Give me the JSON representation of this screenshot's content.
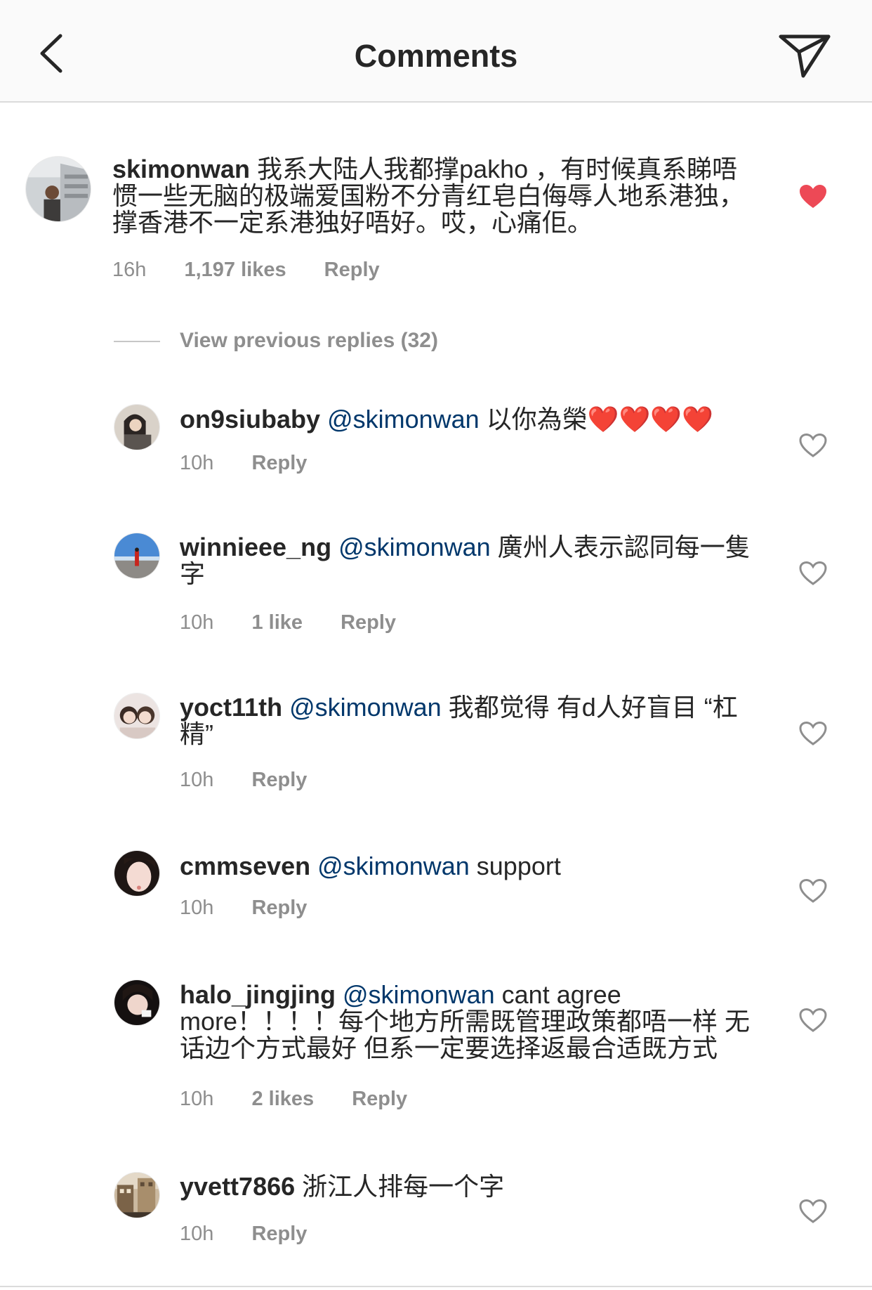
{
  "header": {
    "title": "Comments"
  },
  "main_comment": {
    "username": "skimonwan",
    "text": "我系大陆人我都撑pakho ，有时候真系睇唔惯一些无脑的极端爱国粉不分青红皂白侮辱人地系港独，撑香港不一定系港独好唔好。哎，心痛佢。",
    "time": "16h",
    "likes": "1,197 likes",
    "reply": "Reply",
    "liked": true
  },
  "view_previous": "View previous replies (32)",
  "replies": [
    {
      "username": "on9siubaby",
      "mention": "@skimonwan",
      "text": "以你為榮❤️❤️❤️❤️",
      "time": "10h",
      "likes": "",
      "reply": "Reply"
    },
    {
      "username": "winnieee_ng",
      "mention": "@skimonwan",
      "text": "廣州人表示認同每一隻字",
      "time": "10h",
      "likes": "1 like",
      "reply": "Reply"
    },
    {
      "username": "yoct11th",
      "mention": "@skimonwan",
      "text": "我都觉得 有d人好盲目 “杠精”",
      "time": "10h",
      "likes": "",
      "reply": "Reply"
    },
    {
      "username": "cmmseven",
      "mention": "@skimonwan",
      "text": "support",
      "time": "10h",
      "likes": "",
      "reply": "Reply"
    },
    {
      "username": "halo_jingjing",
      "mention": "@skimonwan",
      "text": "cant agree more！！！！每个地方所需既管理政策都唔一样 无话边个方式最好 但系一定要选择返最合适既方式",
      "time": "10h",
      "likes": "2 likes",
      "reply": "Reply"
    },
    {
      "username": "yvett7866",
      "mention": "",
      "text": "浙江人排每一个字",
      "time": "10h",
      "likes": "",
      "reply": "Reply"
    }
  ],
  "colors": {
    "heart_liked": "#ed4956",
    "mention": "#00376b",
    "meta": "#8e8e8e",
    "icon_outline": "#8e8e8e"
  },
  "icons": {
    "back": "chevron-left-icon",
    "send": "paper-plane-icon",
    "like": "heart-icon"
  }
}
